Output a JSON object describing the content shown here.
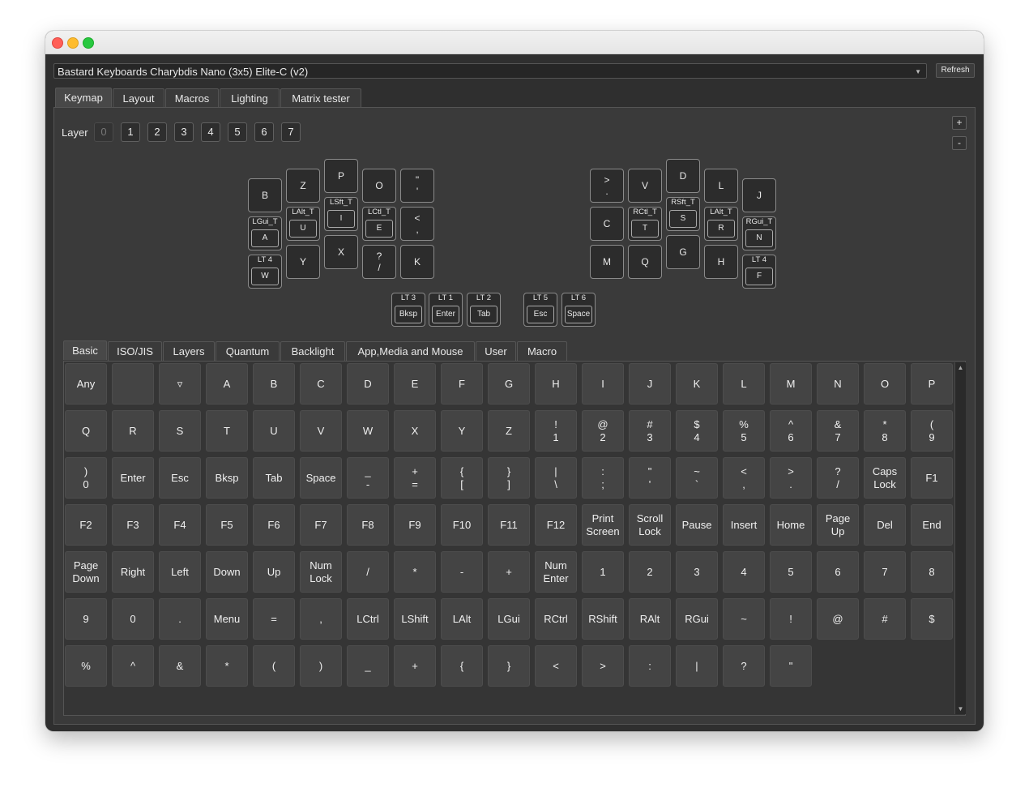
{
  "keyboard_select": {
    "value": "Bastard Keyboards Charybdis Nano (3x5) Elite-C (v2)"
  },
  "refresh_label": "Refresh",
  "main_tabs": [
    "Keymap",
    "Layout",
    "Macros",
    "Lighting",
    "Matrix tester"
  ],
  "layer": {
    "label": "Layer",
    "layers": [
      "0",
      "1",
      "2",
      "3",
      "4",
      "5",
      "6",
      "7"
    ],
    "active": "0"
  },
  "side_buttons": {
    "add": "+",
    "remove": "-"
  },
  "keymap": {
    "left": [
      {
        "main": "B"
      },
      {
        "main": "Z"
      },
      {
        "main": "P"
      },
      {
        "main": "O"
      },
      {
        "main": "\"\n'"
      },
      {
        "top": "LGui_T",
        "inner": "A"
      },
      {
        "top": "LAlt_T",
        "inner": "U"
      },
      {
        "top": "LSft_T",
        "inner": "I"
      },
      {
        "top": "LCtl_T",
        "inner": "E"
      },
      {
        "main": "<\n,"
      },
      {
        "top": "LT 4",
        "inner": "W"
      },
      {
        "main": "Y"
      },
      {
        "main": "X"
      },
      {
        "main": "?\n/"
      },
      {
        "main": "K"
      }
    ],
    "right": [
      {
        "main": ">\n."
      },
      {
        "main": "V"
      },
      {
        "main": "D"
      },
      {
        "main": "L"
      },
      {
        "main": "J"
      },
      {
        "main": "C"
      },
      {
        "top": "RCtl_T",
        "inner": "T"
      },
      {
        "top": "RSft_T",
        "inner": "S"
      },
      {
        "top": "LAlt_T",
        "inner": "R"
      },
      {
        "top": "RGui_T",
        "inner": "N"
      },
      {
        "main": "M"
      },
      {
        "main": "Q"
      },
      {
        "main": "G"
      },
      {
        "main": "H"
      },
      {
        "top": "LT 4",
        "inner": "F"
      }
    ],
    "thumbs_left": [
      {
        "top": "LT 3",
        "inner": "Bksp"
      },
      {
        "top": "LT 1",
        "inner": "Enter"
      },
      {
        "top": "LT 2",
        "inner": "Tab"
      }
    ],
    "thumbs_right": [
      {
        "top": "LT 5",
        "inner": "Esc"
      },
      {
        "top": "LT 6",
        "inner": "Space"
      }
    ]
  },
  "key_tabs": [
    "Basic",
    "ISO/JIS",
    "Layers",
    "Quantum",
    "Backlight",
    "App,Media and Mouse",
    "User",
    "Macro"
  ],
  "basic_keys": [
    "Any",
    "",
    "▿",
    "A",
    "B",
    "C",
    "D",
    "E",
    "F",
    "G",
    "H",
    "I",
    "J",
    "K",
    "L",
    "M",
    "N",
    "O",
    "P",
    "Q",
    "R",
    "S",
    "T",
    "U",
    "V",
    "W",
    "X",
    "Y",
    "Z",
    "!\n1",
    "@\n2",
    "#\n3",
    "$\n4",
    "%\n5",
    "^\n6",
    "&\n7",
    "*\n8",
    "(\n9",
    ")\n0",
    "Enter",
    "Esc",
    "Bksp",
    "Tab",
    "Space",
    "_\n-",
    "+\n=",
    "{\n[",
    "}\n]",
    "|\n\\",
    ":\n;",
    "\"\n'",
    "~\n`",
    "<\n,",
    ">\n.",
    "?\n/",
    "Caps\nLock",
    "F1",
    "F2",
    "F3",
    "F4",
    "F5",
    "F6",
    "F7",
    "F8",
    "F9",
    "F10",
    "F11",
    "F12",
    "Print\nScreen",
    "Scroll\nLock",
    "Pause",
    "Insert",
    "Home",
    "Page\nUp",
    "Del",
    "End",
    "Page\nDown",
    "Right",
    "Left",
    "Down",
    "Up",
    "Num\nLock",
    "/",
    "*",
    "-",
    "+",
    "Num\nEnter",
    "1",
    "2",
    "3",
    "4",
    "5",
    "6",
    "7",
    "8",
    "9",
    "0",
    ".",
    "Menu",
    "=",
    ",",
    "LCtrl",
    "LShift",
    "LAlt",
    "LGui",
    "RCtrl",
    "RShift",
    "RAlt",
    "RGui",
    "~",
    "!",
    "@",
    "#",
    "$",
    "%",
    "^",
    "&",
    "*",
    "(",
    ")",
    "_",
    "+",
    "{",
    "}",
    "<",
    ">",
    ":",
    "|",
    "?",
    "\""
  ]
}
